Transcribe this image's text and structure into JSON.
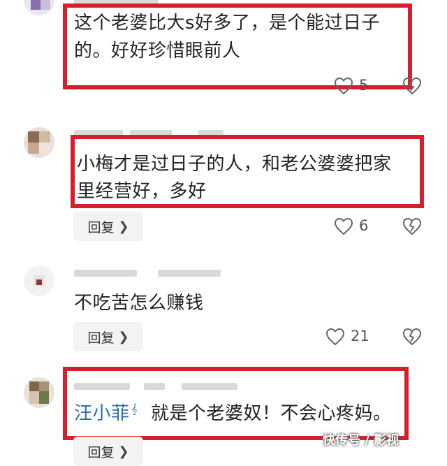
{
  "comments": [
    {
      "text_line1": "这个老婆比大s好多了，是个能过日子",
      "text_line2": "的。好好珍惜眼前人",
      "likes": "5"
    },
    {
      "text_line1": "小梅才是过日子的人，和老公婆婆把家",
      "text_line2": "里经营好，多好",
      "reply_label": "回复",
      "likes": "6"
    },
    {
      "text_line1": "不吃苦怎么赚钱",
      "reply_label": "回复",
      "likes": "21"
    },
    {
      "mention": "汪小菲",
      "text_line1": "就是个老婆奴！不会心疼妈。",
      "reply_label": "回复"
    }
  ],
  "watermark": "快传号 / 影视",
  "colors": {
    "highlight": "#d81e2c",
    "mention": "#2b6cb0",
    "reply_bg": "#f3f3f3"
  },
  "icons": [
    "heart-icon",
    "dislike-heart-icon",
    "chevron-right-icon",
    "mention-icon"
  ]
}
